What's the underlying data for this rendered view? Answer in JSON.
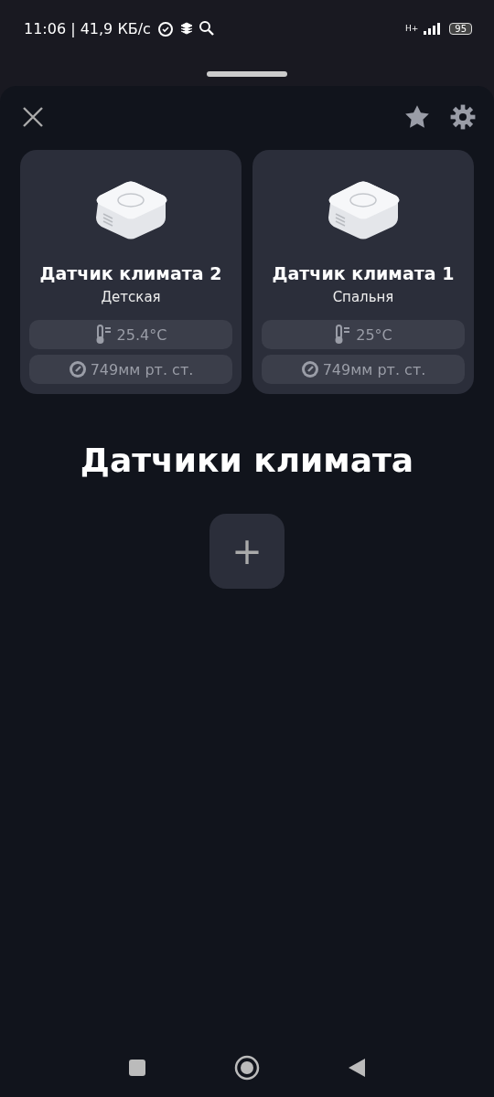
{
  "status_bar": {
    "time": "11:06 | 41,9 КБ/с",
    "network": "H+",
    "battery": "95"
  },
  "sensors": [
    {
      "name": "Датчик климата 2",
      "room": "Детская",
      "temperature": "25.4°C",
      "pressure": "749мм рт. ст."
    },
    {
      "name": "Датчик климата 1",
      "room": "Спальня",
      "temperature": "25°C",
      "pressure": "749мм рт. ст."
    }
  ],
  "title": "Датчики климата",
  "add_button": {
    "label": "+"
  }
}
